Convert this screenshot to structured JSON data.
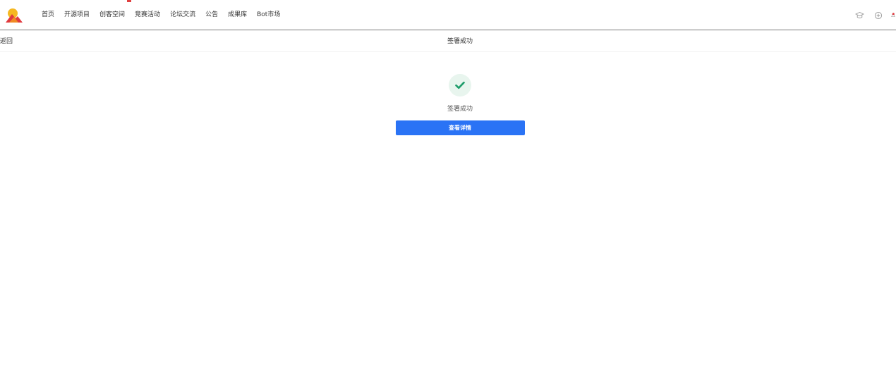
{
  "nav": {
    "items": [
      {
        "label": "首页"
      },
      {
        "label": "开源项目"
      },
      {
        "label": "创客空间"
      },
      {
        "label": "竞赛活动"
      },
      {
        "label": "论坛交流"
      },
      {
        "label": "公告"
      },
      {
        "label": "成果库"
      },
      {
        "label": "Bot市场"
      }
    ]
  },
  "subheader": {
    "back_label": "返回",
    "title": "签署成功"
  },
  "result": {
    "message": "签署成功",
    "button_label": "查看详情"
  },
  "icons": {
    "logo": "sun-logo-icon",
    "top_right": [
      "graduation-cap-icon",
      "plus-circle-icon",
      "bell-icon"
    ],
    "success": "check-icon"
  },
  "colors": {
    "primary": "#2a73f5",
    "success": "#1f9d6b",
    "success_bg": "#e8f5ee",
    "logo_orange": "#f5a623",
    "logo_red": "#e0393e"
  }
}
